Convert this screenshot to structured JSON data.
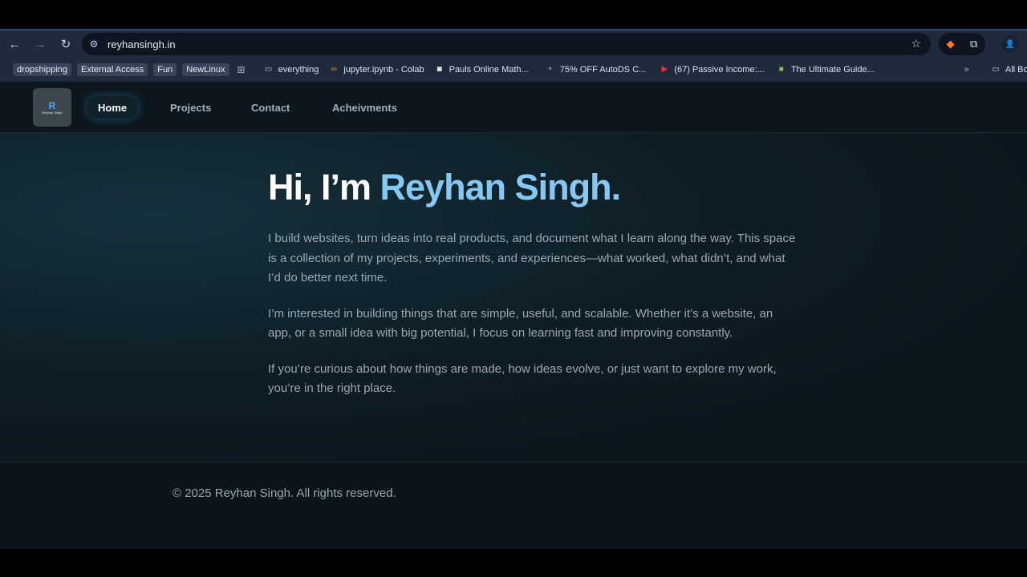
{
  "browser": {
    "url": "reyhansingh.in",
    "profile_initial": "👤",
    "bookmarks": [
      {
        "label": "dropshipping",
        "kind": "chip"
      },
      {
        "label": "External Access",
        "kind": "chip"
      },
      {
        "label": "Fun",
        "kind": "chip"
      },
      {
        "label": "NewLinux",
        "kind": "chip"
      },
      {
        "label": "everything",
        "kind": "folder"
      },
      {
        "label": "jupyter.ipynb - Colab",
        "kind": "link",
        "icon": "colab-icon"
      },
      {
        "label": "Pauls Online Math...",
        "kind": "link",
        "icon": "pauls-icon"
      },
      {
        "label": "75% OFF AutoDS C...",
        "kind": "link",
        "icon": "autods-icon"
      },
      {
        "label": "(67) Passive Income:...",
        "kind": "link",
        "icon": "youtube-icon"
      },
      {
        "label": "The Ultimate Guide...",
        "kind": "link",
        "icon": "shopify-icon"
      }
    ],
    "all_bookmarks_label": "All Bookm"
  },
  "site": {
    "logo": {
      "letter": "R",
      "name": "Reyhan Singh"
    },
    "nav": [
      "Home",
      "Projects",
      "Contact",
      "Acheivments"
    ],
    "active_nav": "Home",
    "hero": {
      "title_prefix": "Hi, I’m ",
      "title_name": "Reyhan Singh.",
      "paragraphs": [
        "I build websites, turn ideas into real products, and document what I learn along the way. This space is a collection of my projects, experiments, and experiences—what worked, what didn’t, and what I’d do better next time.",
        "I’m interested in building things that are simple, useful, and scalable. Whether it’s a website, an app, or a small idea with big potential, I focus on learning fast and improving constantly.",
        "If you’re curious about how things are made, how ideas evolve, or just want to explore my work, you’re in the right place."
      ]
    },
    "footer": "© 2025 Reyhan Singh. All rights reserved."
  },
  "colors": {
    "accent": "#86c8f1",
    "background": "#0e1820",
    "chrome": "#1f2a3d"
  }
}
